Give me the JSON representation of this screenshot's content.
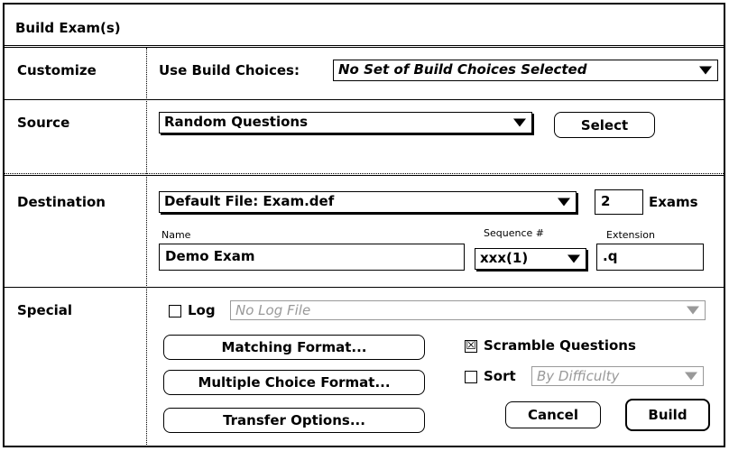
{
  "dialog": {
    "title": "Build Exam(s)"
  },
  "customize": {
    "label": "Customize",
    "choices_label": "Use Build Choices:",
    "choices_value": "No Set of Build Choices Selected"
  },
  "source": {
    "label": "Source",
    "value": "Random Questions",
    "select_button": "Select"
  },
  "destination": {
    "label": "Destination",
    "file_value": "Default File: Exam.def",
    "exam_count": "2",
    "exams_label": "Exams",
    "name_label": "Name",
    "name_value": "Demo Exam",
    "sequence_label": "Sequence #",
    "sequence_value": "xxx(1)",
    "extension_label": "Extension",
    "extension_value": ".q"
  },
  "special": {
    "label": "Special",
    "log_label": "Log",
    "log_value": "No Log File",
    "matching_button": "Matching Format...",
    "multiple_choice_button": "Multiple Choice Format...",
    "transfer_button": "Transfer Options...",
    "scramble_label": "Scramble Questions",
    "scramble_checked": "☒",
    "sort_label": "Sort",
    "sort_value": "By Difficulty",
    "cancel_button": "Cancel",
    "build_button": "Build"
  }
}
